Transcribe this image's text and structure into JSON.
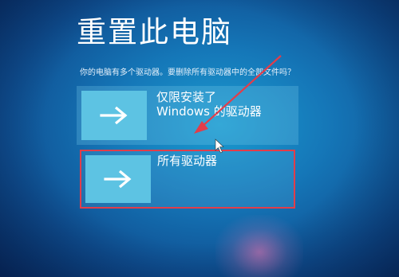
{
  "page": {
    "title": "重置此电脑",
    "question": "你的电脑有多个驱动器。要删除所有驱动器中的全部文件吗？"
  },
  "options": [
    {
      "line1": "仅限安装了",
      "line2": "Windows 的驱动器",
      "icon": "arrow-right-icon"
    },
    {
      "line1": "所有驱动器",
      "icon": "arrow-right-icon"
    }
  ],
  "colors": {
    "background": "#1577b8",
    "tile": "#5dc3e3",
    "annotation": "#e23d4a"
  }
}
